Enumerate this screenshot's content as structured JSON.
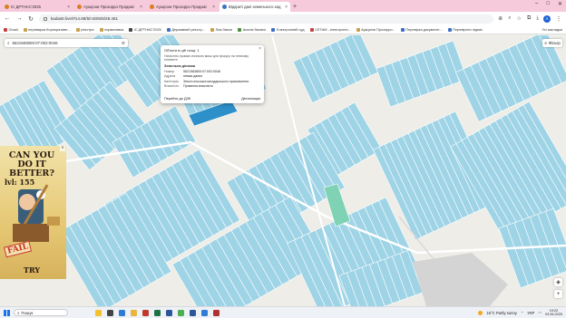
{
  "browser": {
    "tabs": [
      {
        "title": "ІС ДРТНАС'2025",
        "active": false,
        "icon": "tab-favicon"
      },
      {
        "title": "Аукціони Прозорро Продажі",
        "active": false,
        "icon": "tab-favicon"
      },
      {
        "title": "Аукціони Прозорро Продажі",
        "active": false,
        "icon": "tab-favicon"
      },
      {
        "title": "Відкриті дані земельного кад",
        "active": true,
        "icon": "tab-favicon"
      }
    ],
    "address": "kadastr.live/#14.68/50.60926/29.461"
  },
  "bookmarks": [
    {
      "label": "Gmail",
      "color": "#c64040"
    },
    {
      "label": "переварка Корпоративн...",
      "color": "#c8a04a"
    },
    {
      "label": "реєстри",
      "color": "#c8a04a"
    },
    {
      "label": "нормативка",
      "color": "#c8a04a"
    },
    {
      "label": "ІС ДРТНАС'2025",
      "color": "#444444"
    },
    {
      "label": "Державний реєстр...",
      "color": "#3d6fc4"
    },
    {
      "label": "Ліга:Закон",
      "color": "#c8a04a"
    },
    {
      "label": "Аналіз баланс",
      "color": "#4b8f3a"
    },
    {
      "label": "Електронний суд",
      "color": "#3d6fc4"
    },
    {
      "label": "СЕТАМ - електронні...",
      "color": "#c64040"
    },
    {
      "label": "Аукціони Прозорро...",
      "color": "#c8a04a"
    },
    {
      "label": "Перевірка документі...",
      "color": "#3d6fc4"
    },
    {
      "label": "Перевірити підпис",
      "color": "#3d6fc4"
    }
  ],
  "bookmarks_end": "Усі закладки",
  "search": {
    "value": "5621583800:07:002:0046"
  },
  "popup": {
    "title": "Об'єкти в цій точці: 1",
    "description": "Натисніть праває кнопкою миші для фокусу на певному елементі",
    "section": "Земельна ділянка",
    "rows": [
      {
        "key": "Номер",
        "value": "5621583800:07:002:0046"
      },
      {
        "key": "Адреса",
        "value": "немає даних"
      },
      {
        "key": "Категорія",
        "value": "Землі сільськогосподарського призначення"
      },
      {
        "key": "Власність",
        "value": "Приватна власність"
      }
    ],
    "goto_label": "Перейти до ДЗК",
    "details_label": "Деталізація"
  },
  "layers_label": "Фільтр",
  "ad": {
    "headline": "CAN YOU DO IT BETTER?",
    "level": "lvl: 155",
    "fail": "FAIL",
    "cta": "TRY"
  },
  "taskbar": {
    "search_placeholder": "Пошук",
    "weather": "16°C Partly sunny",
    "lang": "УКР",
    "time": "19:22",
    "date": "03.06.2025"
  },
  "colors": {
    "parcel": "#9fd4e6",
    "parcel_selected": "#2e90c9",
    "parcel_green": "#7fd3b4"
  }
}
